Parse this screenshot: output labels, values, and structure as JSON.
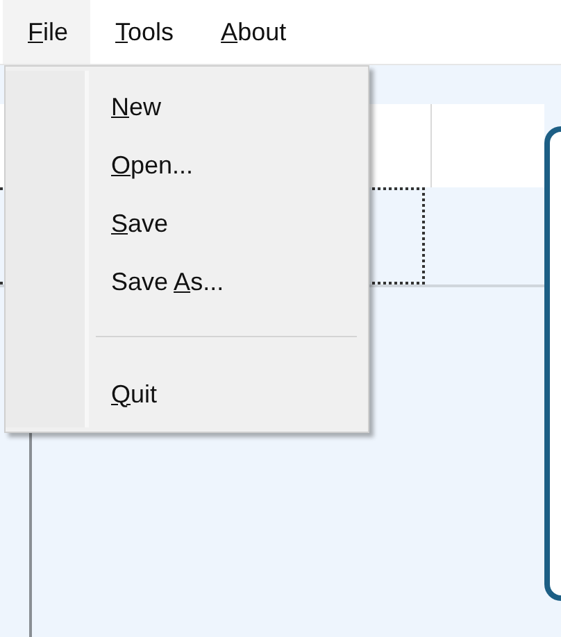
{
  "menu_bar": [
    {
      "access_key": "F",
      "text_after": "ile",
      "selected": true
    },
    {
      "access_key": "T",
      "text_after": "ools",
      "selected": false
    },
    {
      "access_key": "A",
      "text_after": "bout",
      "selected": false
    }
  ],
  "file_menu": {
    "items": [
      {
        "kind": "item",
        "access_key": "N",
        "text_after": "ew"
      },
      {
        "kind": "item",
        "access_key": "O",
        "text_after": "pen..."
      },
      {
        "kind": "item",
        "access_key": "S",
        "text_after": "ave"
      },
      {
        "kind": "item",
        "text_before": "Save ",
        "access_key": "A",
        "text_after": "s..."
      },
      {
        "kind": "separator"
      },
      {
        "kind": "item",
        "access_key": "Q",
        "text_after": "uit"
      }
    ]
  }
}
